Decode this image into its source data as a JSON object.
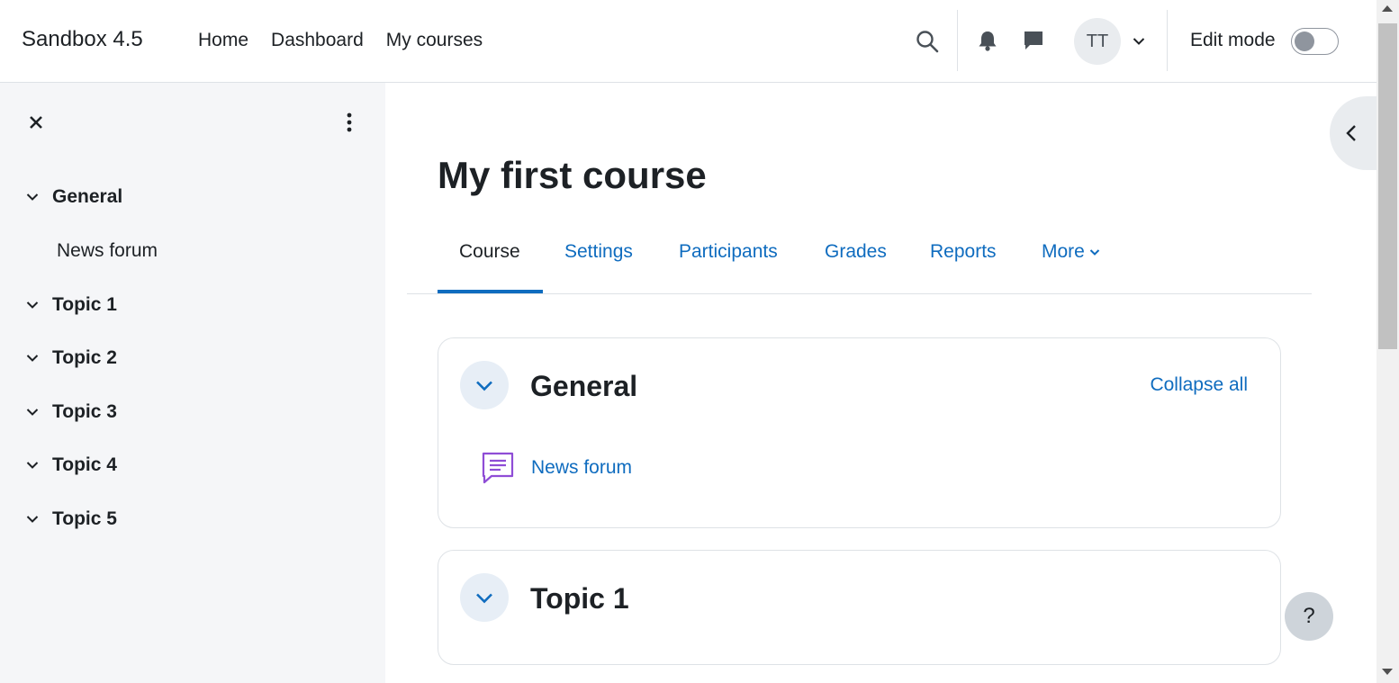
{
  "navbar": {
    "brand": "Sandbox 4.5",
    "links": [
      "Home",
      "Dashboard",
      "My courses"
    ],
    "search_icon": "search-icon",
    "notifications_icon": "bell-icon",
    "messages_icon": "chat-bubble-icon",
    "user_initials": "TT",
    "edit_mode_label": "Edit mode",
    "edit_mode_on": false
  },
  "course_index": {
    "items": [
      {
        "label": "General",
        "children": [
          "News forum"
        ]
      },
      {
        "label": "Topic 1"
      },
      {
        "label": "Topic 2"
      },
      {
        "label": "Topic 3"
      },
      {
        "label": "Topic 4"
      },
      {
        "label": "Topic 5"
      }
    ]
  },
  "page": {
    "title": "My first course",
    "tabs": [
      "Course",
      "Settings",
      "Participants",
      "Grades",
      "Reports",
      "More"
    ],
    "active_tab": "Course"
  },
  "sections": [
    {
      "title": "General",
      "collapse_label": "Collapse all",
      "activities": [
        {
          "name": "News forum",
          "icon": "forum-icon"
        }
      ]
    },
    {
      "title": "Topic 1"
    }
  ],
  "help_label": "?",
  "colors": {
    "accent": "#0f6cbf",
    "drawer_bg": "#f5f6f8",
    "forum_icon": "#8f4dd6"
  }
}
